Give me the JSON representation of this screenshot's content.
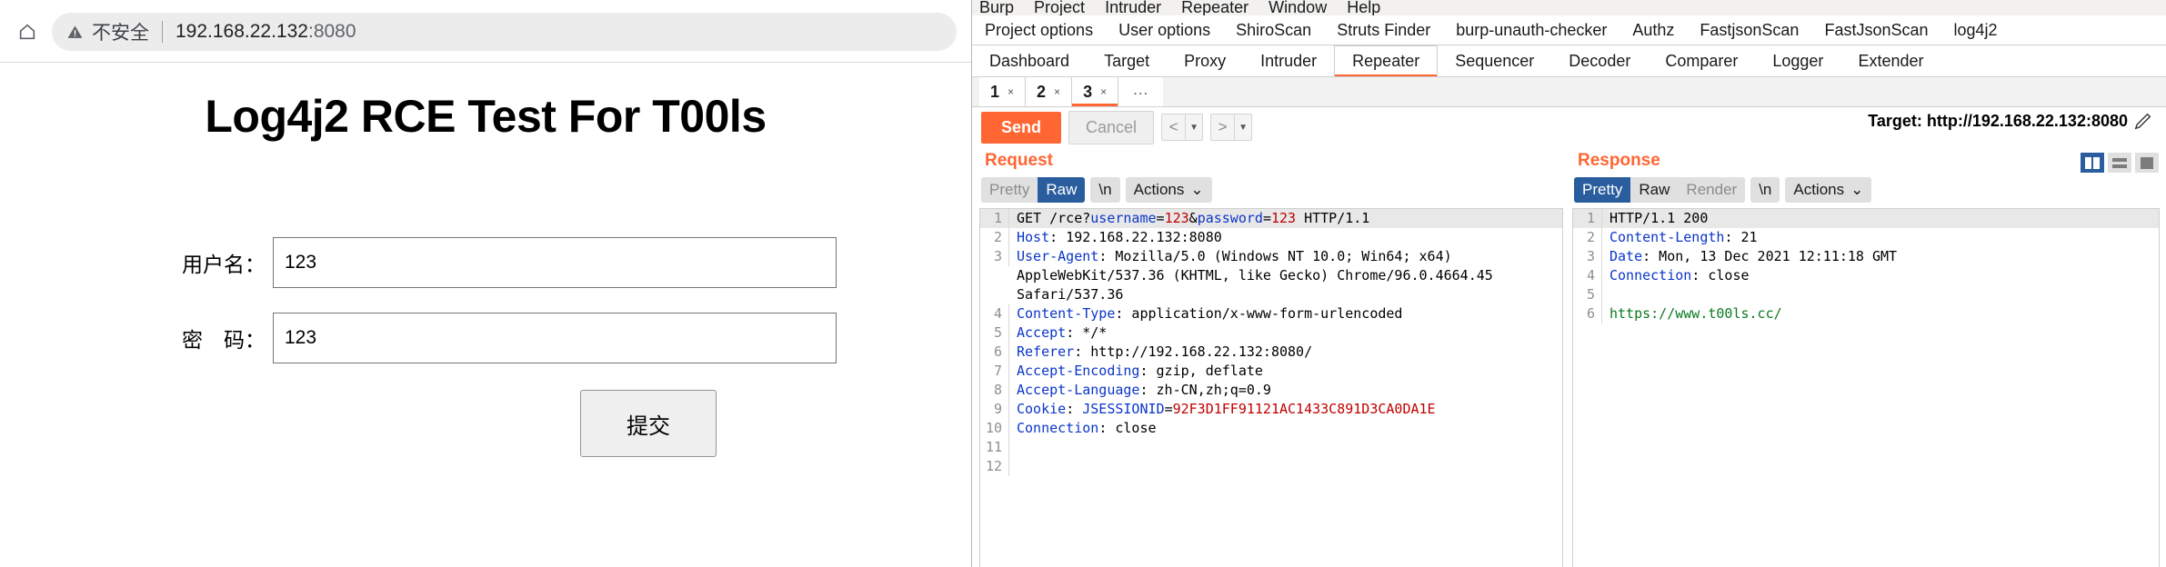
{
  "browser": {
    "home_icon": "home-icon",
    "security_warning_icon": "warning-triangle-icon",
    "security_label": "不安全",
    "url": "192.168.22.132",
    "url_port": ":8080",
    "page": {
      "title": "Log4j2 RCE Test For T00ls",
      "fields": [
        {
          "label": "用户名：",
          "value": "123",
          "name": "username-field"
        },
        {
          "label": "密　码：",
          "value": "123",
          "name": "password-field"
        }
      ],
      "submit_label": "提交"
    }
  },
  "burp": {
    "menu": [
      "Burp",
      "Project",
      "Intruder",
      "Repeater",
      "Window",
      "Help"
    ],
    "extension_tabs": [
      "Project options",
      "User options",
      "ShiroScan",
      "Struts Finder",
      "burp-unauth-checker",
      "Authz",
      "FastjsonScan",
      "FastJsonScan",
      "log4j2"
    ],
    "main_tabs": [
      {
        "label": "Dashboard",
        "active": false
      },
      {
        "label": "Target",
        "active": false
      },
      {
        "label": "Proxy",
        "active": false
      },
      {
        "label": "Intruder",
        "active": false
      },
      {
        "label": "Repeater",
        "active": true
      },
      {
        "label": "Sequencer",
        "active": false
      },
      {
        "label": "Decoder",
        "active": false
      },
      {
        "label": "Comparer",
        "active": false
      },
      {
        "label": "Logger",
        "active": false
      },
      {
        "label": "Extender",
        "active": false
      }
    ],
    "sub_tabs": [
      {
        "label": "1",
        "close": "×",
        "active": false
      },
      {
        "label": "2",
        "close": "×",
        "active": false
      },
      {
        "label": "3",
        "close": "×",
        "active": true
      }
    ],
    "sub_tabs_more": "...",
    "send_label": "Send",
    "cancel_label": "Cancel",
    "nav_prev_icon": "chevron-left-icon",
    "nav_next_icon": "chevron-right-icon",
    "target_label": "Target: http://192.168.22.132:8080",
    "edit_icon": "pencil-edit-icon",
    "layout_icons": [
      "split-vertical-icon",
      "split-horizontal-icon",
      "maximize-icon"
    ],
    "request": {
      "title": "Request",
      "view_modes": [
        {
          "label": "Pretty",
          "state": "inactive"
        },
        {
          "label": "Raw",
          "state": "selected"
        }
      ],
      "newline_label": "\\n",
      "actions_label": "Actions",
      "actions_caret_icon": "chevron-down-icon",
      "lines": [
        {
          "n": "1",
          "highlight": true,
          "parts": [
            {
              "t": "GET /rce?",
              "c": "val"
            },
            {
              "t": "username",
              "c": "hdr"
            },
            {
              "t": "=",
              "c": "val"
            },
            {
              "t": "123",
              "c": "red"
            },
            {
              "t": "&",
              "c": "val"
            },
            {
              "t": "password",
              "c": "hdr"
            },
            {
              "t": "=",
              "c": "val"
            },
            {
              "t": "123",
              "c": "red"
            },
            {
              "t": " HTTP/1.1",
              "c": "val"
            }
          ]
        },
        {
          "n": "2",
          "parts": [
            {
              "t": "Host",
              "c": "hdr"
            },
            {
              "t": ": 192.168.22.132:8080",
              "c": "val"
            }
          ]
        },
        {
          "n": "3",
          "parts": [
            {
              "t": "User-Agent",
              "c": "hdr"
            },
            {
              "t": ": Mozilla/5.0 (Windows NT 10.0; Win64; x64)",
              "c": "val"
            }
          ]
        },
        {
          "n": "",
          "parts": [
            {
              "t": "AppleWebKit/537.36 (KHTML, like Gecko) Chrome/96.0.4664.45",
              "c": "val"
            }
          ]
        },
        {
          "n": "",
          "parts": [
            {
              "t": "Safari/537.36",
              "c": "val"
            }
          ]
        },
        {
          "n": "4",
          "parts": [
            {
              "t": "Content-Type",
              "c": "hdr"
            },
            {
              "t": ": application/x-www-form-urlencoded",
              "c": "val"
            }
          ]
        },
        {
          "n": "5",
          "parts": [
            {
              "t": "Accept",
              "c": "hdr"
            },
            {
              "t": ": */*",
              "c": "val"
            }
          ]
        },
        {
          "n": "6",
          "parts": [
            {
              "t": "Referer",
              "c": "hdr"
            },
            {
              "t": ": http://192.168.22.132:8080/",
              "c": "val"
            }
          ]
        },
        {
          "n": "7",
          "parts": [
            {
              "t": "Accept-Encoding",
              "c": "hdr"
            },
            {
              "t": ": gzip, deflate",
              "c": "val"
            }
          ]
        },
        {
          "n": "8",
          "parts": [
            {
              "t": "Accept-Language",
              "c": "hdr"
            },
            {
              "t": ": zh-CN,zh;q=0.9",
              "c": "val"
            }
          ]
        },
        {
          "n": "9",
          "parts": [
            {
              "t": "Cookie",
              "c": "hdr"
            },
            {
              "t": ": ",
              "c": "val"
            },
            {
              "t": "JSESSIONID",
              "c": "hdr"
            },
            {
              "t": "=",
              "c": "val"
            },
            {
              "t": "92F3D1FF91121AC1433C891D3CA0DA1E",
              "c": "red"
            }
          ]
        },
        {
          "n": "10",
          "parts": [
            {
              "t": "Connection",
              "c": "hdr"
            },
            {
              "t": ": close",
              "c": "val"
            }
          ]
        },
        {
          "n": "11",
          "parts": []
        },
        {
          "n": "12",
          "parts": []
        }
      ]
    },
    "response": {
      "title": "Response",
      "view_modes": [
        {
          "label": "Pretty",
          "state": "selected"
        },
        {
          "label": "Raw",
          "state": "active"
        },
        {
          "label": "Render",
          "state": "inactive"
        }
      ],
      "newline_label": "\\n",
      "actions_label": "Actions",
      "actions_caret_icon": "chevron-down-icon",
      "lines": [
        {
          "n": "1",
          "highlight": true,
          "parts": [
            {
              "t": "HTTP/1.1 200",
              "c": "val"
            }
          ]
        },
        {
          "n": "2",
          "parts": [
            {
              "t": "Content-Length",
              "c": "hdr"
            },
            {
              "t": ": 21",
              "c": "val"
            }
          ]
        },
        {
          "n": "3",
          "parts": [
            {
              "t": "Date",
              "c": "hdr"
            },
            {
              "t": ": Mon, 13 Dec 2021 12:11:18 GMT",
              "c": "val"
            }
          ]
        },
        {
          "n": "4",
          "parts": [
            {
              "t": "Connection",
              "c": "hdr"
            },
            {
              "t": ": close",
              "c": "val"
            }
          ]
        },
        {
          "n": "5",
          "parts": []
        },
        {
          "n": "6",
          "parts": [
            {
              "t": "https://www.t00ls.cc/",
              "c": "green"
            }
          ]
        }
      ]
    }
  }
}
